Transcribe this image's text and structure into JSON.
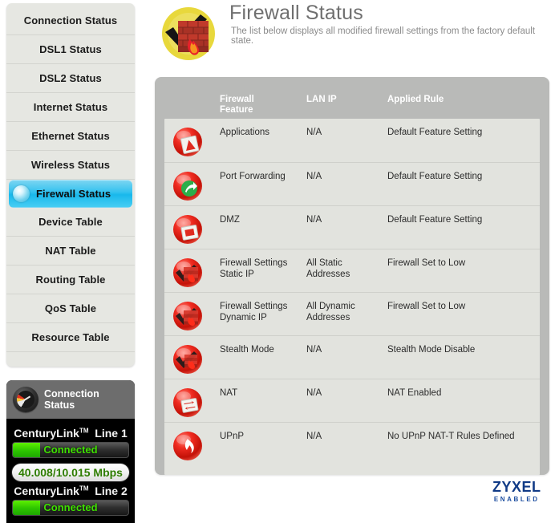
{
  "sidebar": {
    "items": [
      {
        "label": "Connection Status",
        "selected": false,
        "name": "sidebar-item-connection-status"
      },
      {
        "label": "DSL1 Status",
        "selected": false,
        "name": "sidebar-item-dsl1-status"
      },
      {
        "label": "DSL2 Status",
        "selected": false,
        "name": "sidebar-item-dsl2-status"
      },
      {
        "label": "Internet Status",
        "selected": false,
        "name": "sidebar-item-internet-status"
      },
      {
        "label": "Ethernet Status",
        "selected": false,
        "name": "sidebar-item-ethernet-status"
      },
      {
        "label": "Wireless Status",
        "selected": false,
        "name": "sidebar-item-wireless-status"
      },
      {
        "label": "Firewall Status",
        "selected": true,
        "name": "sidebar-item-firewall-status"
      },
      {
        "label": "Device Table",
        "selected": false,
        "name": "sidebar-item-device-table"
      },
      {
        "label": "NAT Table",
        "selected": false,
        "name": "sidebar-item-nat-table"
      },
      {
        "label": "Routing Table",
        "selected": false,
        "name": "sidebar-item-routing-table"
      },
      {
        "label": "QoS Table",
        "selected": false,
        "name": "sidebar-item-qos-table"
      },
      {
        "label": "Resource Table",
        "selected": false,
        "name": "sidebar-item-resource-table"
      }
    ]
  },
  "connection_panel": {
    "title": "Connection\nStatus",
    "icon": "speed-gauge-icon",
    "lines": [
      {
        "brand": "CenturyLink",
        "trademark": "TM",
        "line_name": "Line 1",
        "status": "Connected",
        "status_color": "#3fe000",
        "speed": "40.008/10.015 Mbps",
        "speed_color": "#2e7d00"
      },
      {
        "brand": "CenturyLink",
        "trademark": "TM",
        "line_name": "Line 2",
        "status": "Connected",
        "status_color": "#3fe000",
        "speed": "",
        "speed_color": "#2e7d00"
      }
    ]
  },
  "header": {
    "icon": "firewall-brick-flame-icon",
    "title": "Firewall Status",
    "subtitle": "The list below displays all modified firewall settings from the factory default state."
  },
  "table": {
    "columns": [
      {
        "label": "Firewall\nFeature",
        "name": "column-header-firewall-feature"
      },
      {
        "label": "LAN IP",
        "name": "column-header-lan-ip"
      },
      {
        "label": "Applied Rule",
        "name": "column-header-applied-rule"
      }
    ],
    "rows": [
      {
        "icon": "applications-shield-icon",
        "feature": "Applications",
        "lan_ip": "N/A",
        "applied_rule": "Default Feature Setting"
      },
      {
        "icon": "port-forwarding-arrow-icon",
        "feature": "Port Forwarding",
        "lan_ip": "N/A",
        "applied_rule": "Default Feature Setting"
      },
      {
        "icon": "dmz-icon",
        "feature": "DMZ",
        "lan_ip": "N/A",
        "applied_rule": "Default Feature Setting"
      },
      {
        "icon": "firewall-settings-static-icon",
        "feature": "Firewall Settings\nStatic IP",
        "lan_ip": "All Static\nAddresses",
        "applied_rule": "Firewall Set to Low"
      },
      {
        "icon": "firewall-settings-dynamic-icon",
        "feature": "Firewall Settings\nDynamic IP",
        "lan_ip": "All Dynamic\nAddresses",
        "applied_rule": "Firewall Set to Low"
      },
      {
        "icon": "stealth-mode-icon",
        "feature": "Stealth Mode",
        "lan_ip": "N/A",
        "applied_rule": "Stealth Mode Disable"
      },
      {
        "icon": "nat-icon",
        "feature": "NAT",
        "lan_ip": "N/A",
        "applied_rule": "NAT Enabled"
      },
      {
        "icon": "upnp-icon",
        "feature": "UPnP",
        "lan_ip": "N/A",
        "applied_rule": "No UPnP NAT-T Rules Defined"
      }
    ]
  },
  "footer": {
    "logo_word": "ZYXEL",
    "logo_sub": "ENABLED",
    "logo_color": "#103a86"
  },
  "colors": {
    "panel_bg": "#b9bab8",
    "row_bg": "#e2e3de",
    "sidebar_bg": "#e6e7e2",
    "selected_accent": "#19b8ec",
    "title_gray": "#6f6f6f"
  }
}
